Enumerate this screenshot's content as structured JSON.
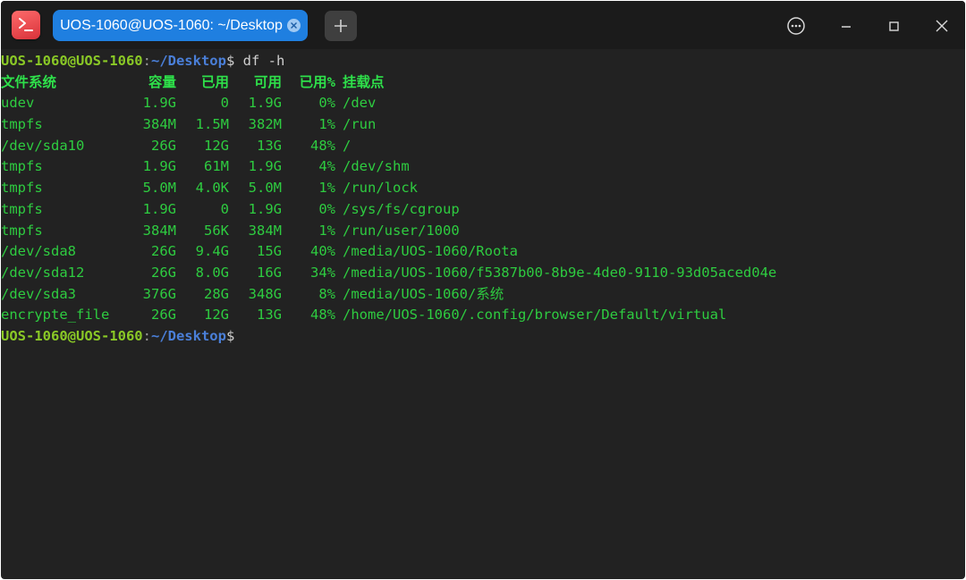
{
  "tab": {
    "title": "UOS-1060@UOS-1060: ~/Desktop"
  },
  "icons": {
    "app": "terminal-app-icon",
    "tab_close": "close-circle-icon",
    "new_tab": "plus-icon",
    "menu": "ellipsis-circle-icon",
    "minimize": "minimize-icon",
    "maximize": "maximize-icon",
    "close": "close-icon"
  },
  "colors": {
    "tab_active": "#1f7fe0",
    "prompt_user": "#8ac926",
    "prompt_path": "#4a7fd8",
    "output": "#2ecc40"
  },
  "terminal": {
    "prompt": {
      "user": "UOS-1060@UOS-1060",
      "sep": ":",
      "path": "~/Desktop",
      "dollar": "$"
    },
    "command": " df -h",
    "header": [
      "文件系统",
      "容量",
      "已用",
      "可用",
      "已用%",
      "挂载点"
    ],
    "rows": [
      [
        "udev",
        "1.9G",
        "0",
        "1.9G",
        "0%",
        "/dev"
      ],
      [
        "tmpfs",
        "384M",
        "1.5M",
        "382M",
        "1%",
        "/run"
      ],
      [
        "/dev/sda10",
        "26G",
        "12G",
        "13G",
        "48%",
        "/"
      ],
      [
        "tmpfs",
        "1.9G",
        "61M",
        "1.9G",
        "4%",
        "/dev/shm"
      ],
      [
        "tmpfs",
        "5.0M",
        "4.0K",
        "5.0M",
        "1%",
        "/run/lock"
      ],
      [
        "tmpfs",
        "1.9G",
        "0",
        "1.9G",
        "0%",
        "/sys/fs/cgroup"
      ],
      [
        "tmpfs",
        "384M",
        "56K",
        "384M",
        "1%",
        "/run/user/1000"
      ],
      [
        "/dev/sda8",
        "26G",
        "9.4G",
        "15G",
        "40%",
        "/media/UOS-1060/Roota"
      ],
      [
        "/dev/sda12",
        "26G",
        "8.0G",
        "16G",
        "34%",
        "/media/UOS-1060/f5387b00-8b9e-4de0-9110-93d05aced04e"
      ],
      [
        "/dev/sda3",
        "376G",
        "28G",
        "348G",
        "8%",
        "/media/UOS-1060/系统"
      ],
      [
        "encrypte_file",
        "26G",
        "12G",
        "13G",
        "48%",
        "/home/UOS-1060/.config/browser/Default/virtual"
      ]
    ]
  }
}
